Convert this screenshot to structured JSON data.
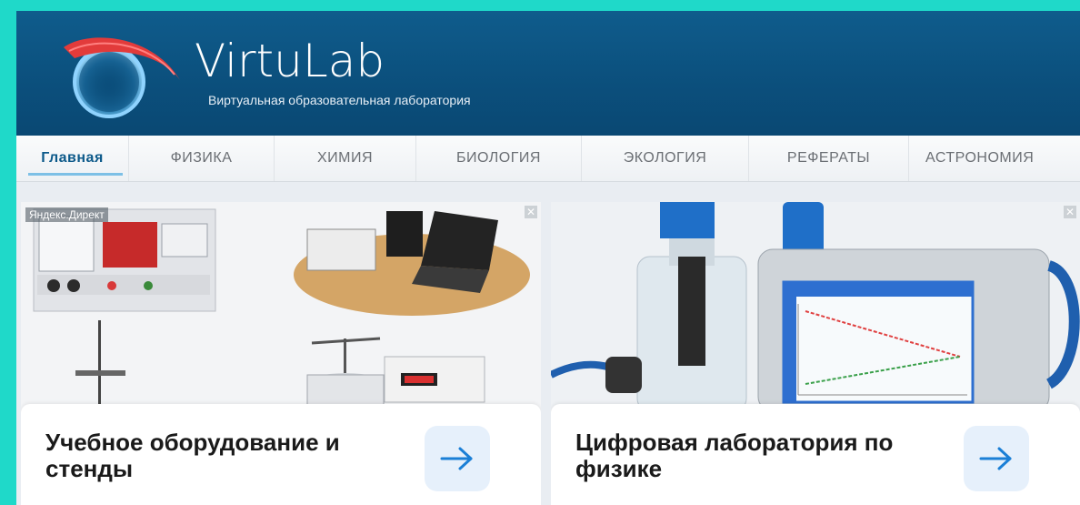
{
  "site": {
    "name": "VirtuLab",
    "tagline": "Виртуальная образовательная лаборатория"
  },
  "nav": {
    "items": [
      {
        "label": "Главная",
        "active": true
      },
      {
        "label": "ФИЗИКА",
        "active": false
      },
      {
        "label": "ХИМИЯ",
        "active": false
      },
      {
        "label": "БИОЛОГИЯ",
        "active": false
      },
      {
        "label": "ЭКОЛОГИЯ",
        "active": false
      },
      {
        "label": "РЕФЕРАТЫ",
        "active": false
      },
      {
        "label": "АСТРОНОМИЯ",
        "active": false
      }
    ]
  },
  "ads": {
    "label": "Яндекс.Директ",
    "cards": [
      {
        "title": "Учебное оборудование и стенды",
        "image": "lab-equipment-stands-photo",
        "arrow_icon": "arrow-right-icon",
        "close_icon": "close-icon"
      },
      {
        "title": "Цифровая лаборатория по физике",
        "image": "digital-physics-lab-photo",
        "arrow_icon": "arrow-right-icon",
        "close_icon": "close-icon"
      }
    ]
  },
  "colors": {
    "header": "#0b4f7c",
    "nav_active": "#0d5a8a",
    "arrow": "#1b7fd6",
    "background": "#1fd9c9"
  }
}
